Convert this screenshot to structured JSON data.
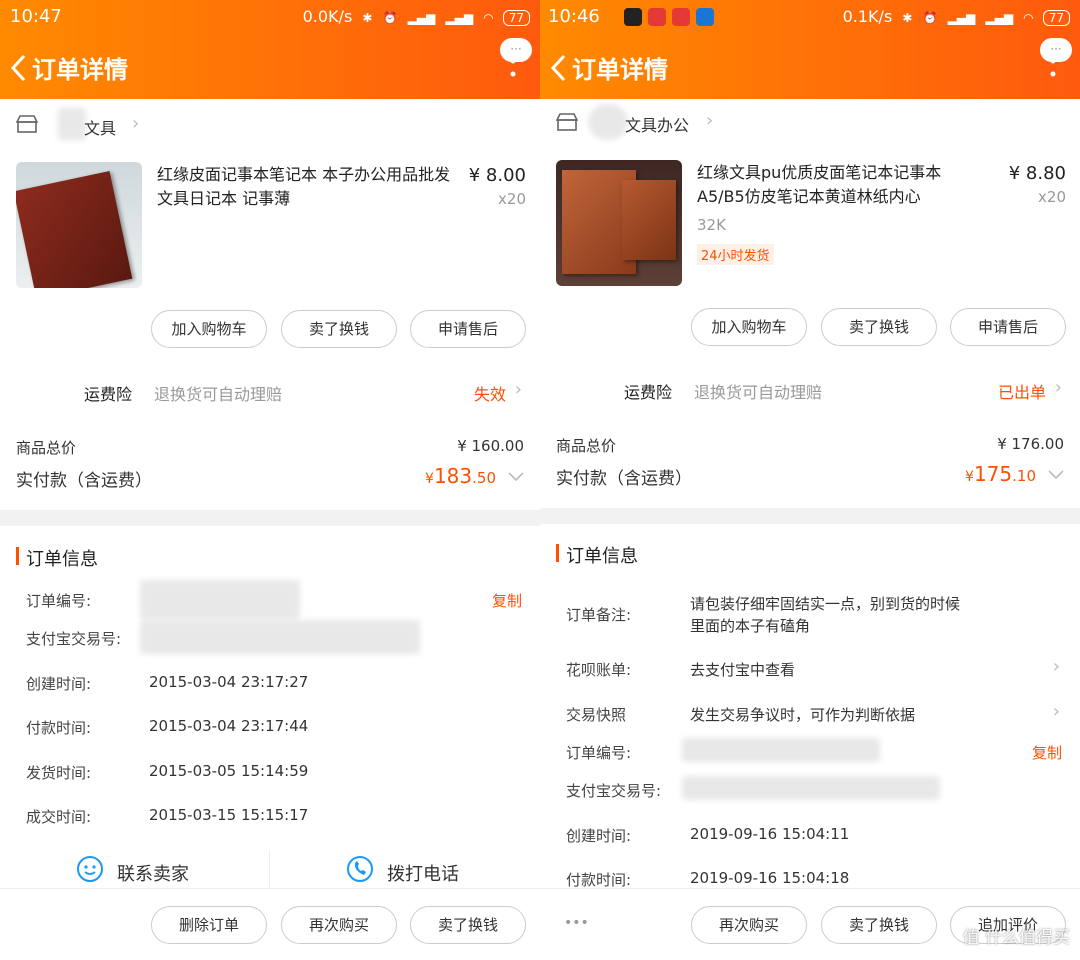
{
  "left": {
    "status": {
      "time": "10:47",
      "net": "0.0K/s",
      "battery": "77"
    },
    "header": {
      "title": "订单详情",
      "more_bubble": "···"
    },
    "shop": {
      "name": "文具"
    },
    "product": {
      "name": "红缘皮面记事本笔记本 本子办公用品批发文具日记本 记事薄",
      "price": "¥ 8.00",
      "qty": "x20"
    },
    "item_actions": [
      "加入购物车",
      "卖了换钱",
      "申请售后"
    ],
    "insurance": {
      "label": "运费险",
      "desc": "退换货可自动理赔",
      "status": "失效"
    },
    "totals": {
      "goods_label": "商品总价",
      "goods_value": "¥ 160.00",
      "paid_label": "实付款（含运费）",
      "paid_currency": "¥",
      "paid_int": "183",
      "paid_dec": ".50"
    },
    "order_info": {
      "title": "订单信息",
      "order_no_label": "订单编号:",
      "copy": "复制",
      "alipay_label": "支付宝交易号:",
      "rows": [
        {
          "label": "创建时间:",
          "value": "2015-03-04 23:17:27"
        },
        {
          "label": "付款时间:",
          "value": "2015-03-04 23:17:44"
        },
        {
          "label": "发货时间:",
          "value": "2015-03-05 15:14:59"
        },
        {
          "label": "成交时间:",
          "value": "2015-03-15 15:15:17"
        }
      ]
    },
    "contact": {
      "seller": "联系卖家",
      "call": "拨打电话"
    },
    "bottom_actions": [
      "删除订单",
      "再次购买",
      "卖了换钱"
    ]
  },
  "right": {
    "status": {
      "time": "10:46",
      "net": "0.1K/s",
      "battery": "77"
    },
    "header": {
      "title": "订单详情",
      "more_bubble": "···"
    },
    "shop": {
      "name": "文具办公"
    },
    "product": {
      "name": "红缘文具pu优质皮面笔记本记事本A5/B5仿皮笔记本黄道林纸内心",
      "sku": "32K",
      "badge": "24小时发货",
      "price": "¥ 8.80",
      "qty": "x20"
    },
    "item_actions": [
      "加入购物车",
      "卖了换钱",
      "申请售后"
    ],
    "insurance": {
      "label": "运费险",
      "desc": "退换货可自动理赔",
      "status": "已出单"
    },
    "totals": {
      "goods_label": "商品总价",
      "goods_value": "¥ 176.00",
      "paid_label": "实付款（含运费）",
      "paid_currency": "¥",
      "paid_int": "175",
      "paid_dec": ".10"
    },
    "order_info": {
      "title": "订单信息",
      "note_label": "订单备注:",
      "note_value_line1": "请包装仔细牢固结实一点，别到货的时候",
      "note_value_line2": "里面的本子有磕角",
      "huabei_label": "花呗账单:",
      "huabei_value": "去支付宝中查看",
      "snapshot_label": "交易快照",
      "snapshot_value": "发生交易争议时，可作为判断依据",
      "order_no_label": "订单编号:",
      "copy": "复制",
      "alipay_label": "支付宝交易号:",
      "rows": [
        {
          "label": "创建时间:",
          "value": "2019-09-16 15:04:11"
        },
        {
          "label": "付款时间:",
          "value": "2019-09-16 15:04:18"
        }
      ]
    },
    "bottom_more": "•••",
    "bottom_actions": [
      "再次购买",
      "卖了换钱",
      "追加评价"
    ],
    "watermark": "值 什么值得买"
  }
}
